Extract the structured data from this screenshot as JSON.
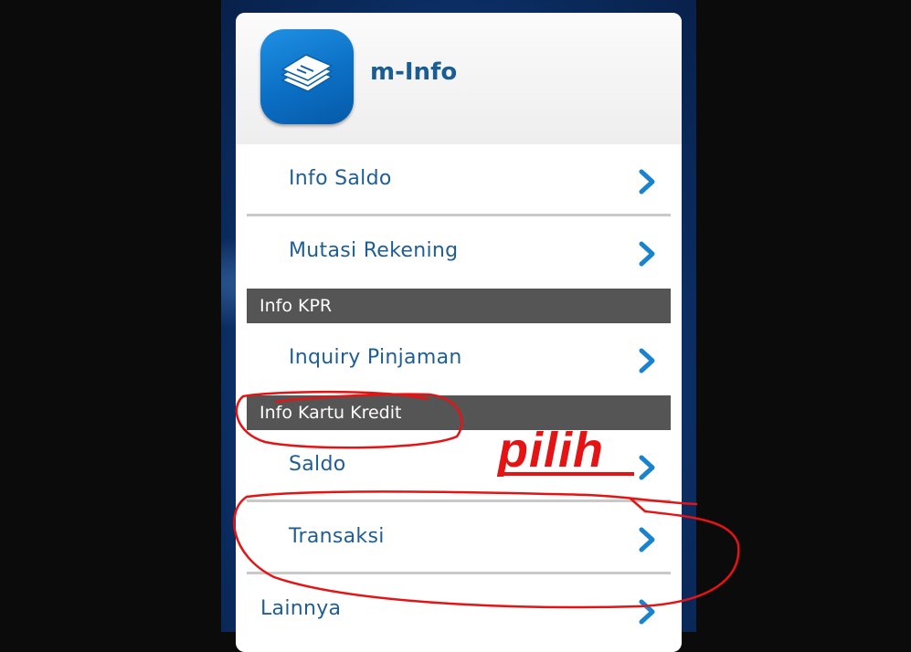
{
  "app": {
    "title": "m-Info",
    "icon": "stacked-cards-icon",
    "brand_color": "#0b6fc4",
    "text_color": "#1f5e94"
  },
  "menu": {
    "info_saldo": "Info Saldo",
    "mutasi_rekening": "Mutasi Rekening",
    "section_kpr": "Info KPR",
    "inquiry_pinjaman": "Inquiry Pinjaman",
    "section_kartu_kredit": "Info Kartu Kredit",
    "saldo": "Saldo",
    "transaksi": "Transaksi",
    "lainnya": "Lainnya"
  },
  "annotation": {
    "text": "pilih",
    "color": "#e41414"
  }
}
